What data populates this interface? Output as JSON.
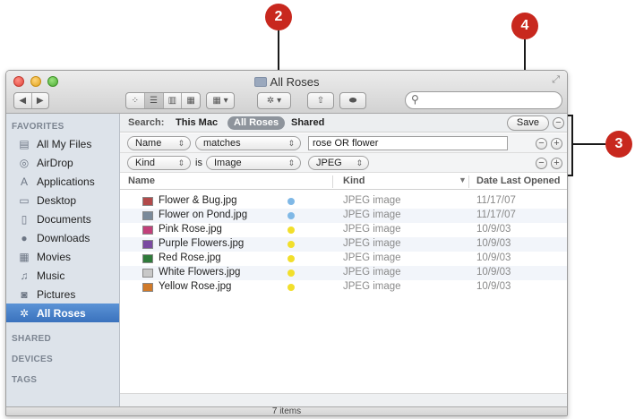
{
  "callouts": {
    "c2": "2",
    "c4": "4",
    "c3": "3"
  },
  "window": {
    "title": "All Roses",
    "status": "7 items"
  },
  "toolbar": {
    "back": "◀",
    "forward": "▶",
    "view_icon": "⁘",
    "view_list": "☰",
    "view_columns": "▥",
    "view_coverflow": "▦",
    "arrange": "▦ ▾",
    "action": "✲ ▾",
    "share": "⇧",
    "tags": "⬬",
    "search_placeholder": ""
  },
  "sidebar": {
    "favorites_header": "FAVORITES",
    "items": [
      {
        "label": "All My Files",
        "icon": "all-my-files-icon",
        "glyph": "▤"
      },
      {
        "label": "AirDrop",
        "icon": "airdrop-icon",
        "glyph": "◎"
      },
      {
        "label": "Applications",
        "icon": "applications-icon",
        "glyph": "A"
      },
      {
        "label": "Desktop",
        "icon": "desktop-icon",
        "glyph": "▭"
      },
      {
        "label": "Documents",
        "icon": "documents-icon",
        "glyph": "▯"
      },
      {
        "label": "Downloads",
        "icon": "downloads-icon",
        "glyph": "●"
      },
      {
        "label": "Movies",
        "icon": "movies-icon",
        "glyph": "▦"
      },
      {
        "label": "Music",
        "icon": "music-icon",
        "glyph": "♫"
      },
      {
        "label": "Pictures",
        "icon": "pictures-icon",
        "glyph": "◙"
      },
      {
        "label": "All Roses",
        "icon": "gear-icon",
        "glyph": "✲"
      }
    ],
    "shared_header": "SHARED",
    "devices_header": "DEVICES",
    "tags_header": "TAGS"
  },
  "search_scope": {
    "label": "Search:",
    "this_mac": "This Mac",
    "all_roses": "All Roses",
    "shared": "Shared",
    "save": "Save"
  },
  "criteria": [
    {
      "attribute": "Name",
      "operator": "matches",
      "value": "rose OR flower"
    },
    {
      "attribute": "Kind",
      "is": "is",
      "operator": "Image",
      "value": "JPEG"
    }
  ],
  "columns": {
    "name": "Name",
    "kind": "Kind",
    "date": "Date Last Opened"
  },
  "files": [
    {
      "name": "Flower & Bug.jpg",
      "kind": "JPEG image",
      "date": "11/17/07",
      "tag_color": "#7fb8e6",
      "thumb": "#b24a4a"
    },
    {
      "name": "Flower on Pond.jpg",
      "kind": "JPEG image",
      "date": "11/17/07",
      "tag_color": "#7fb8e6",
      "thumb": "#7a8a9a"
    },
    {
      "name": "Pink Rose.jpg",
      "kind": "JPEG image",
      "date": "10/9/03",
      "tag_color": "#f2df2b",
      "thumb": "#c2407a"
    },
    {
      "name": "Purple Flowers.jpg",
      "kind": "JPEG image",
      "date": "10/9/03",
      "tag_color": "#f2df2b",
      "thumb": "#7a4aa0"
    },
    {
      "name": "Red Rose.jpg",
      "kind": "JPEG image",
      "date": "10/9/03",
      "tag_color": "#f2df2b",
      "thumb": "#2e7a3a"
    },
    {
      "name": "White Flowers.jpg",
      "kind": "JPEG image",
      "date": "10/9/03",
      "tag_color": "#f2df2b",
      "thumb": "#c8c8c8"
    },
    {
      "name": "Yellow Rose.jpg",
      "kind": "JPEG image",
      "date": "10/9/03",
      "tag_color": "#f2df2b",
      "thumb": "#d07a2a"
    }
  ],
  "colors": {
    "callout": "#c8281e",
    "sidebar_selection": "#3a72bd",
    "sidebar_bg": "#dde3ea"
  }
}
